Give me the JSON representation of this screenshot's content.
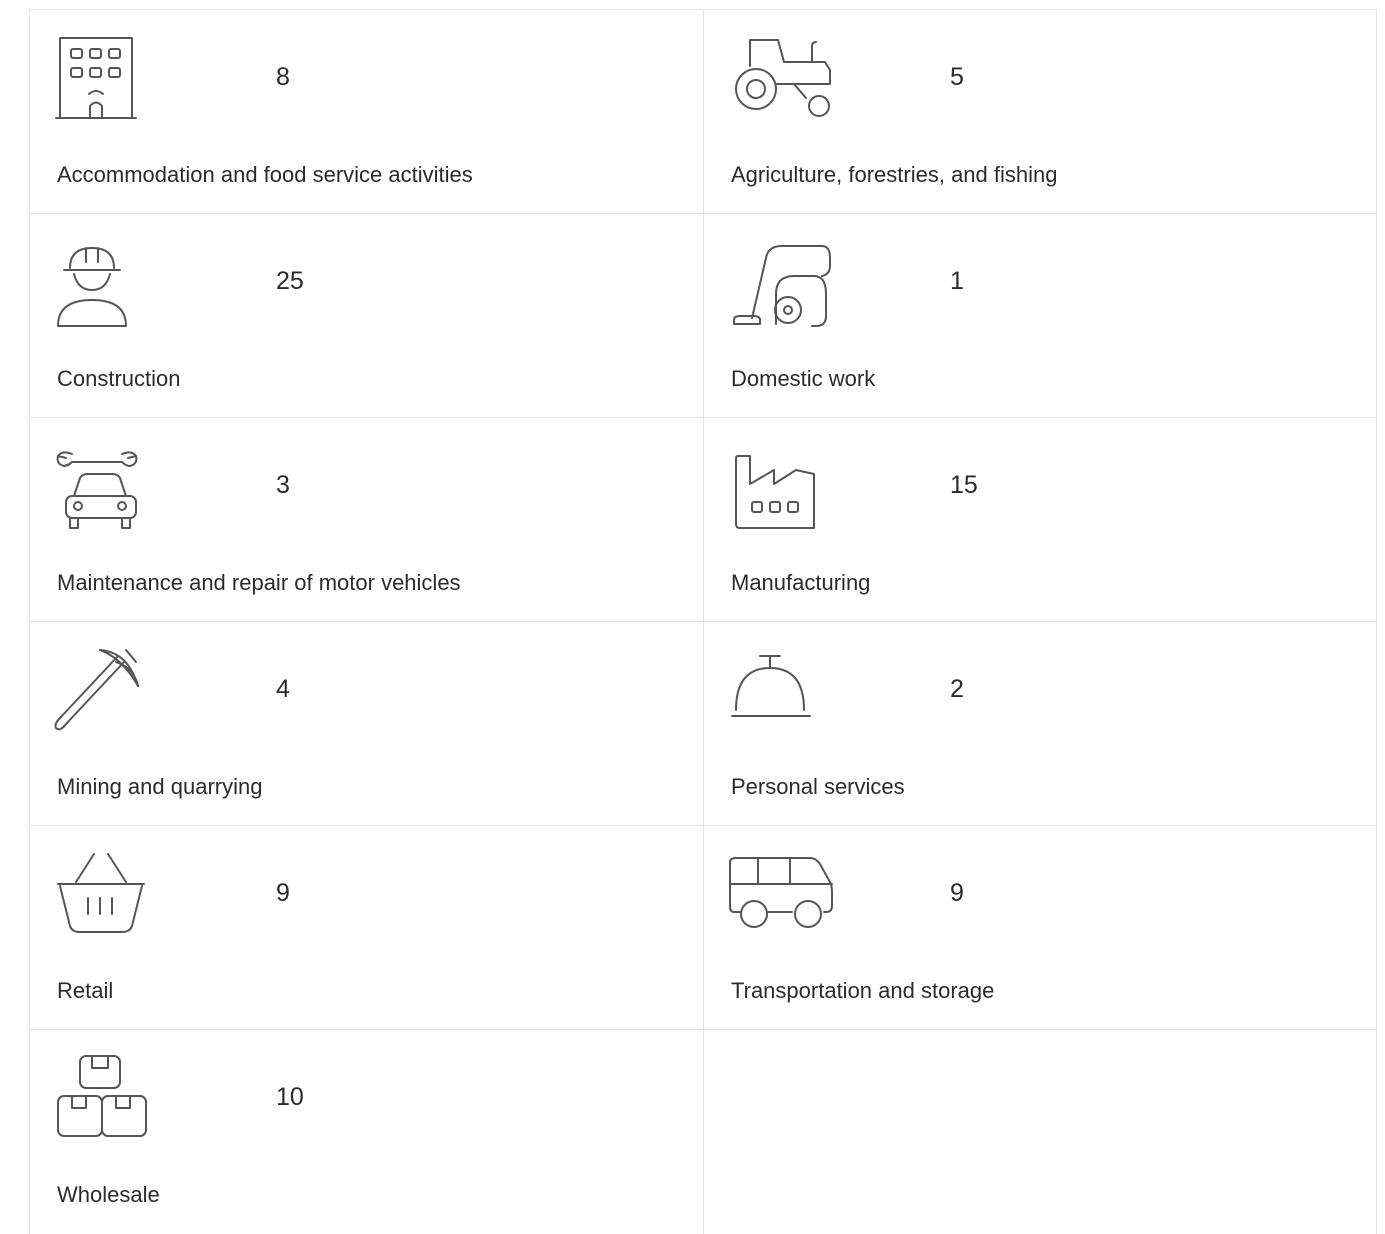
{
  "industries": [
    {
      "label": "Accommodation and food service activities",
      "count": "8",
      "icon": "hotel-icon"
    },
    {
      "label": "Agriculture, forestries, and fishing",
      "count": "5",
      "icon": "tractor-icon"
    },
    {
      "label": "Construction",
      "count": "25",
      "icon": "construction-worker-icon"
    },
    {
      "label": "Domestic work",
      "count": "1",
      "icon": "vacuum-cleaner-icon"
    },
    {
      "label": "Maintenance and repair of motor vehicles",
      "count": "3",
      "icon": "car-repair-icon"
    },
    {
      "label": "Manufacturing",
      "count": "15",
      "icon": "factory-icon"
    },
    {
      "label": "Mining and quarrying",
      "count": "4",
      "icon": "pickaxe-icon"
    },
    {
      "label": "Personal services",
      "count": "2",
      "icon": "service-bell-icon"
    },
    {
      "label": "Retail",
      "count": "9",
      "icon": "shopping-basket-icon"
    },
    {
      "label": "Transportation and storage",
      "count": "9",
      "icon": "van-icon"
    },
    {
      "label": "Wholesale",
      "count": "10",
      "icon": "stacked-boxes-icon"
    }
  ]
}
